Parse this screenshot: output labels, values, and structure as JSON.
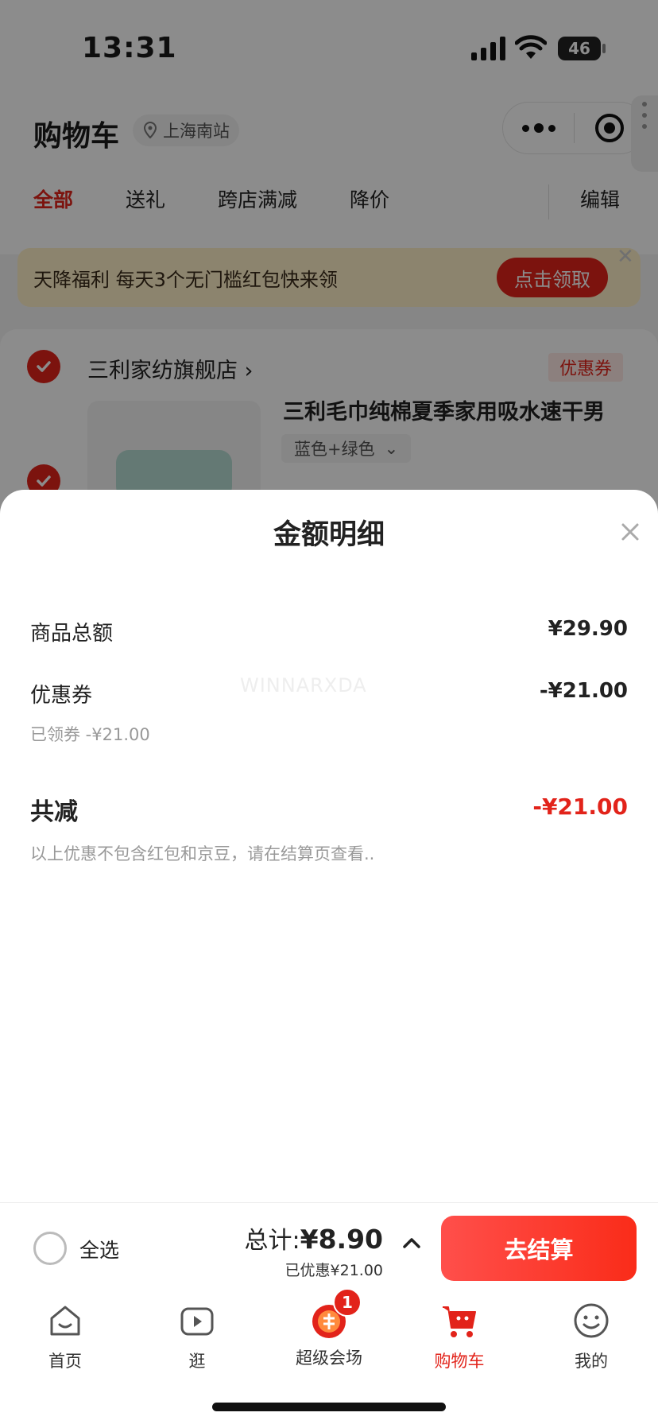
{
  "status_bar": {
    "time": "13:31",
    "battery": "46"
  },
  "header": {
    "title": "购物车",
    "location": "上海南站",
    "tabs": [
      "全部",
      "送礼",
      "跨店满减",
      "降价"
    ],
    "edit_label": "编辑"
  },
  "banner": {
    "text": "天降福利 每天3个无门槛红包快来领",
    "button": "点击领取"
  },
  "store": {
    "name": "三利家纺旗舰店",
    "coupon_tag": "优惠券",
    "product_title": "三利毛巾纯棉夏季家用吸水速干男",
    "sku": "蓝色+绿色"
  },
  "sheet": {
    "title": "金额明细",
    "watermark": "WINNARXDA",
    "rows": [
      {
        "label": "商品总额",
        "value": "¥29.90"
      },
      {
        "label": "优惠券",
        "value": "-¥21.00"
      }
    ],
    "coupon_note": "已领券 -¥21.00",
    "total_label": "共减",
    "total_value": "-¥21.00",
    "disclaimer": "以上优惠不包含红包和京豆，请在结算页查看.."
  },
  "checkout": {
    "select_all": "全选",
    "total_prefix": "总计:",
    "total_amount": "¥8.90",
    "saved": "已优惠¥21.00",
    "pay_button": "去结算"
  },
  "tabbar": {
    "items": [
      "首页",
      "逛",
      "超级会场",
      "购物车",
      "我的"
    ],
    "badge": "1"
  },
  "colors": {
    "accent": "#e2231a"
  }
}
